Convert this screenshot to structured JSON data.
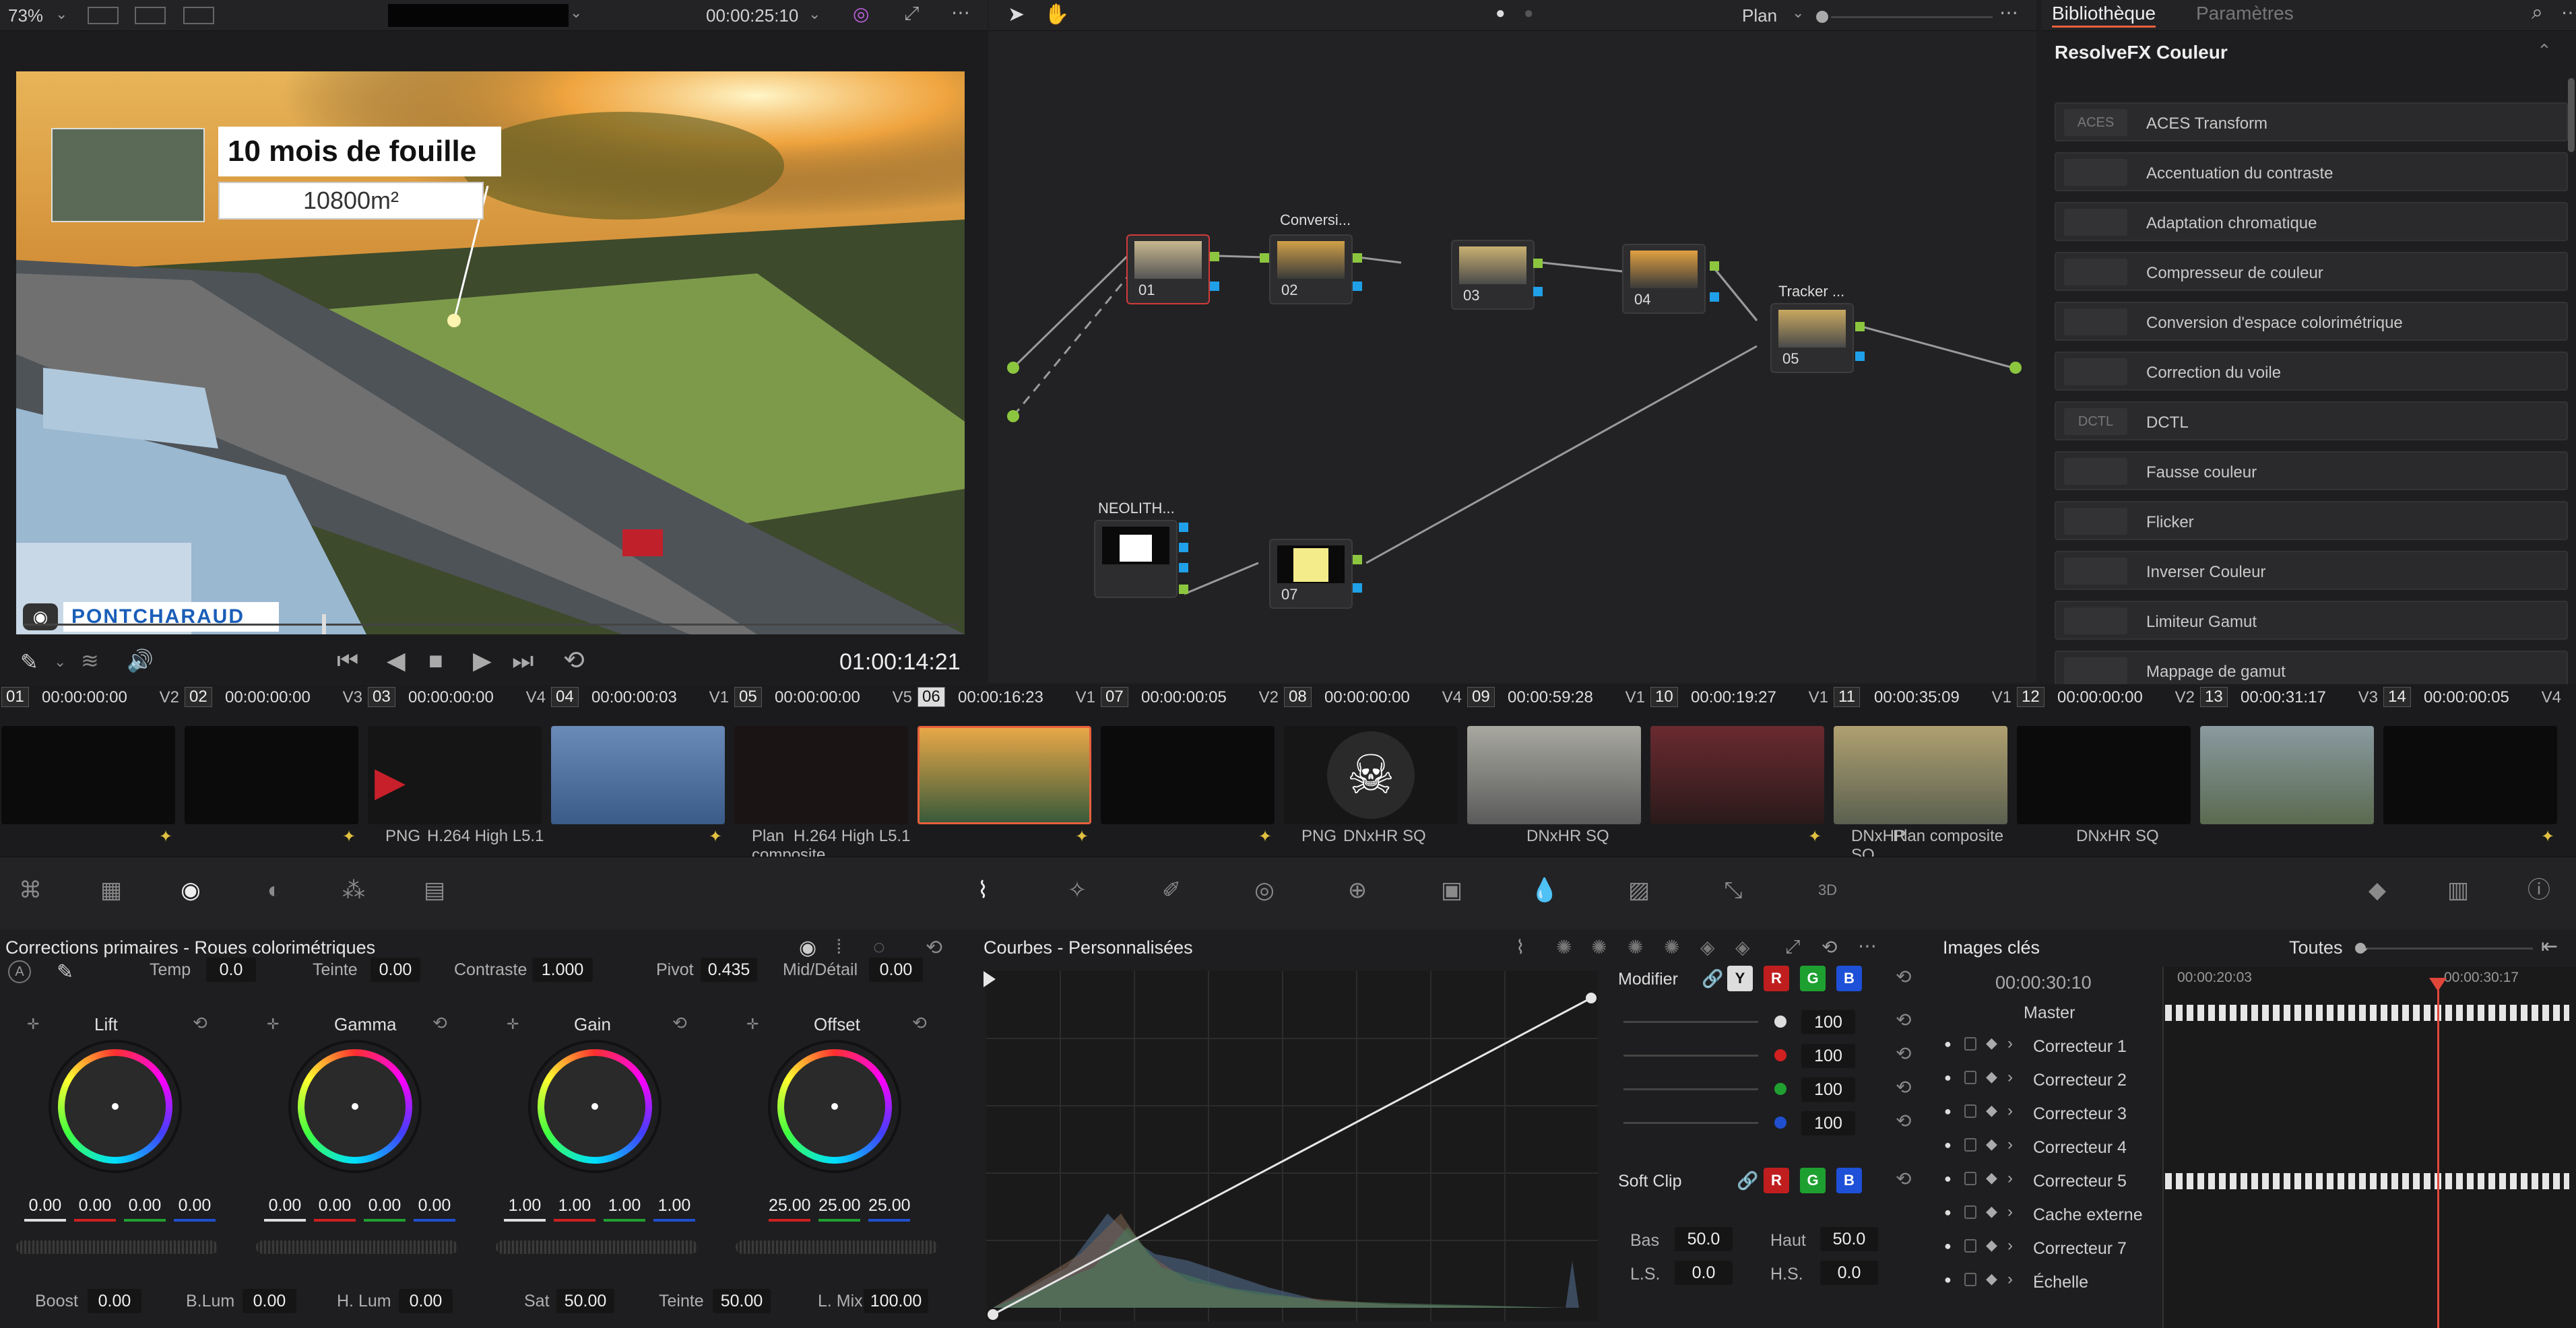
{
  "app": {
    "zoom": "73%",
    "timecode": "00:00:25:10",
    "mode": "Plan"
  },
  "library": {
    "tab_active": "Bibliothèque",
    "tab_inactive": "Paramètres",
    "section": "ResolveFX Couleur",
    "items": [
      {
        "label": "ACES Transform",
        "icon": "ACES"
      },
      {
        "label": "Accentuation du contraste",
        "icon": ""
      },
      {
        "label": "Adaptation chromatique",
        "icon": ""
      },
      {
        "label": "Compresseur de couleur",
        "icon": ""
      },
      {
        "label": "Conversion d'espace colorimétrique",
        "icon": ""
      },
      {
        "label": "Correction du voile",
        "icon": ""
      },
      {
        "label": "DCTL",
        "icon": "DCTL"
      },
      {
        "label": "Fausse couleur",
        "icon": ""
      },
      {
        "label": "Flicker",
        "icon": ""
      },
      {
        "label": "Inverser Couleur",
        "icon": ""
      },
      {
        "label": "Limiteur Gamut",
        "icon": ""
      },
      {
        "label": "Mappage de gamut",
        "icon": ""
      }
    ]
  },
  "viewer": {
    "title_overlay": "10 mois de fouille",
    "area_overlay": "10800m²",
    "logo_text": "PONTCHARAUD",
    "timecode": "01:00:14:21",
    "scrub_position": 0.32
  },
  "nodes": {
    "n01": "01",
    "n02": "02",
    "n02_label": "Conversi...",
    "n03": "03",
    "n04": "04",
    "n05": "05",
    "n05_label": "Tracker ...",
    "n06_label": "NEOLITH...",
    "n07": "07"
  },
  "clips": [
    {
      "num": "01",
      "tc": "00:00:00:00",
      "track": "V2",
      "codec": "",
      "fx": true
    },
    {
      "num": "02",
      "tc": "00:00:00:00",
      "track": "V3",
      "codec": "PNG",
      "fx": true
    },
    {
      "num": "03",
      "tc": "00:00:00:00",
      "track": "V4",
      "codec": "H.264 High L5.1",
      "fx": false
    },
    {
      "num": "04",
      "tc": "00:00:00:03",
      "track": "V1",
      "codec": "Plan composite",
      "fx": true
    },
    {
      "num": "05",
      "tc": "00:00:00:00",
      "track": "V5",
      "codec": "H.264 High L5.1",
      "fx": false
    },
    {
      "num": "06",
      "tc": "00:00:16:23",
      "track": "V1",
      "codec": "",
      "fx": true
    },
    {
      "num": "07",
      "tc": "00:00:00:05",
      "track": "V2",
      "codec": "PNG",
      "fx": true
    },
    {
      "num": "08",
      "tc": "00:00:00:00",
      "track": "V4",
      "codec": "DNxHR SQ",
      "fx": false
    },
    {
      "num": "09",
      "tc": "00:00:59:28",
      "track": "V1",
      "codec": "DNxHR SQ",
      "fx": false
    },
    {
      "num": "10",
      "tc": "00:00:19:27",
      "track": "V1",
      "codec": "DNxHR SQ",
      "fx": true
    },
    {
      "num": "11",
      "tc": "00:00:35:09",
      "track": "V1",
      "codec": "Plan composite",
      "fx": false
    },
    {
      "num": "12",
      "tc": "00:00:00:00",
      "track": "V2",
      "codec": "DNxHR SQ",
      "fx": false
    },
    {
      "num": "13",
      "tc": "00:00:31:17",
      "track": "V3",
      "codec": "",
      "fx": false
    },
    {
      "num": "14",
      "tc": "00:00:00:05",
      "track": "V4",
      "codec": "",
      "fx": true
    }
  ],
  "primaries": {
    "title": "Corrections primaires - Roues colorimétriques",
    "temp_label": "Temp",
    "temp": "0.0",
    "teinte_label": "Teinte",
    "teinte": "0.00",
    "contraste_label": "Contraste",
    "contraste": "1.000",
    "pivot_label": "Pivot",
    "pivot": "0.435",
    "md_label": "Mid/Détail",
    "md": "0.00",
    "wheels": [
      {
        "name": "Lift",
        "v": [
          "0.00",
          "0.00",
          "0.00",
          "0.00"
        ]
      },
      {
        "name": "Gamma",
        "v": [
          "0.00",
          "0.00",
          "0.00",
          "0.00"
        ]
      },
      {
        "name": "Gain",
        "v": [
          "1.00",
          "1.00",
          "1.00",
          "1.00"
        ]
      },
      {
        "name": "Offset",
        "v": [
          "25.00",
          "25.00",
          "25.00"
        ]
      }
    ],
    "boost_label": "Boost",
    "boost": "0.00",
    "blum_label": "B.Lum",
    "blum": "0.00",
    "hlum_label": "H. Lum",
    "hlum": "0.00",
    "sat_label": "Sat",
    "sat": "50.00",
    "teinte2_label": "Teinte",
    "teinte2": "50.00",
    "lmix_label": "L. Mix",
    "lmix": "100.00"
  },
  "curves": {
    "title": "Courbes - Personnalisées",
    "modifier": "Modifier",
    "y": "Y",
    "r": "R",
    "g": "G",
    "b": "B",
    "vals": [
      "100",
      "100",
      "100",
      "100"
    ],
    "softclip": "Soft Clip",
    "bas_label": "Bas",
    "bas": "50.0",
    "haut_label": "Haut",
    "haut": "50.0",
    "ls_label": "L.S.",
    "ls": "0.0",
    "hs_label": "H.S.",
    "hs": "0.0"
  },
  "keyframes": {
    "title": "Images clés",
    "filter": "Toutes",
    "tc": "00:00:30:10",
    "t1": "00:00:20:03",
    "t2": "00:00:30:17",
    "rows": [
      "Master",
      "Correcteur 1",
      "Correcteur 2",
      "Correcteur 3",
      "Correcteur 4",
      "Correcteur 5",
      "Cache externe",
      "Correcteur 7",
      "Échelle"
    ]
  },
  "colors": {
    "accent": "#e8603c",
    "port_green": "#8cc63f",
    "port_blue": "#1fa0e8",
    "playhead": "#e0463a"
  }
}
